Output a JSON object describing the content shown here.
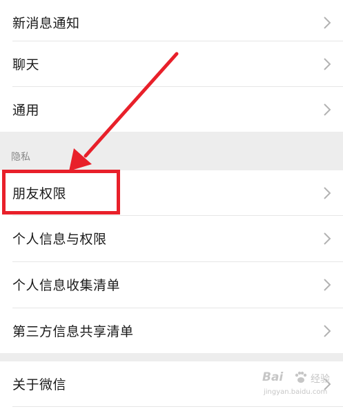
{
  "settings": {
    "top_items": [
      {
        "label": "新消息通知"
      },
      {
        "label": "聊天"
      },
      {
        "label": "通用"
      }
    ],
    "privacy_header": "隐私",
    "privacy_items": [
      {
        "label": "朋友权限"
      },
      {
        "label": "个人信息与权限"
      },
      {
        "label": "个人信息收集清单"
      },
      {
        "label": "第三方信息共享清单"
      }
    ],
    "bottom_items": [
      {
        "label": "关于微信"
      }
    ]
  },
  "annotation": {
    "highlight_color": "#e8202a",
    "highlighted_item": "朋友权限"
  },
  "watermark": {
    "brand": "Bai",
    "brand_suffix": "经验",
    "url": "jingyan.baidu.com"
  },
  "colors": {
    "background": "#ffffff",
    "section_gap": "#ededed",
    "text": "#1a1a1a",
    "chevron": "#b2b2b2",
    "header_text": "#888888"
  }
}
